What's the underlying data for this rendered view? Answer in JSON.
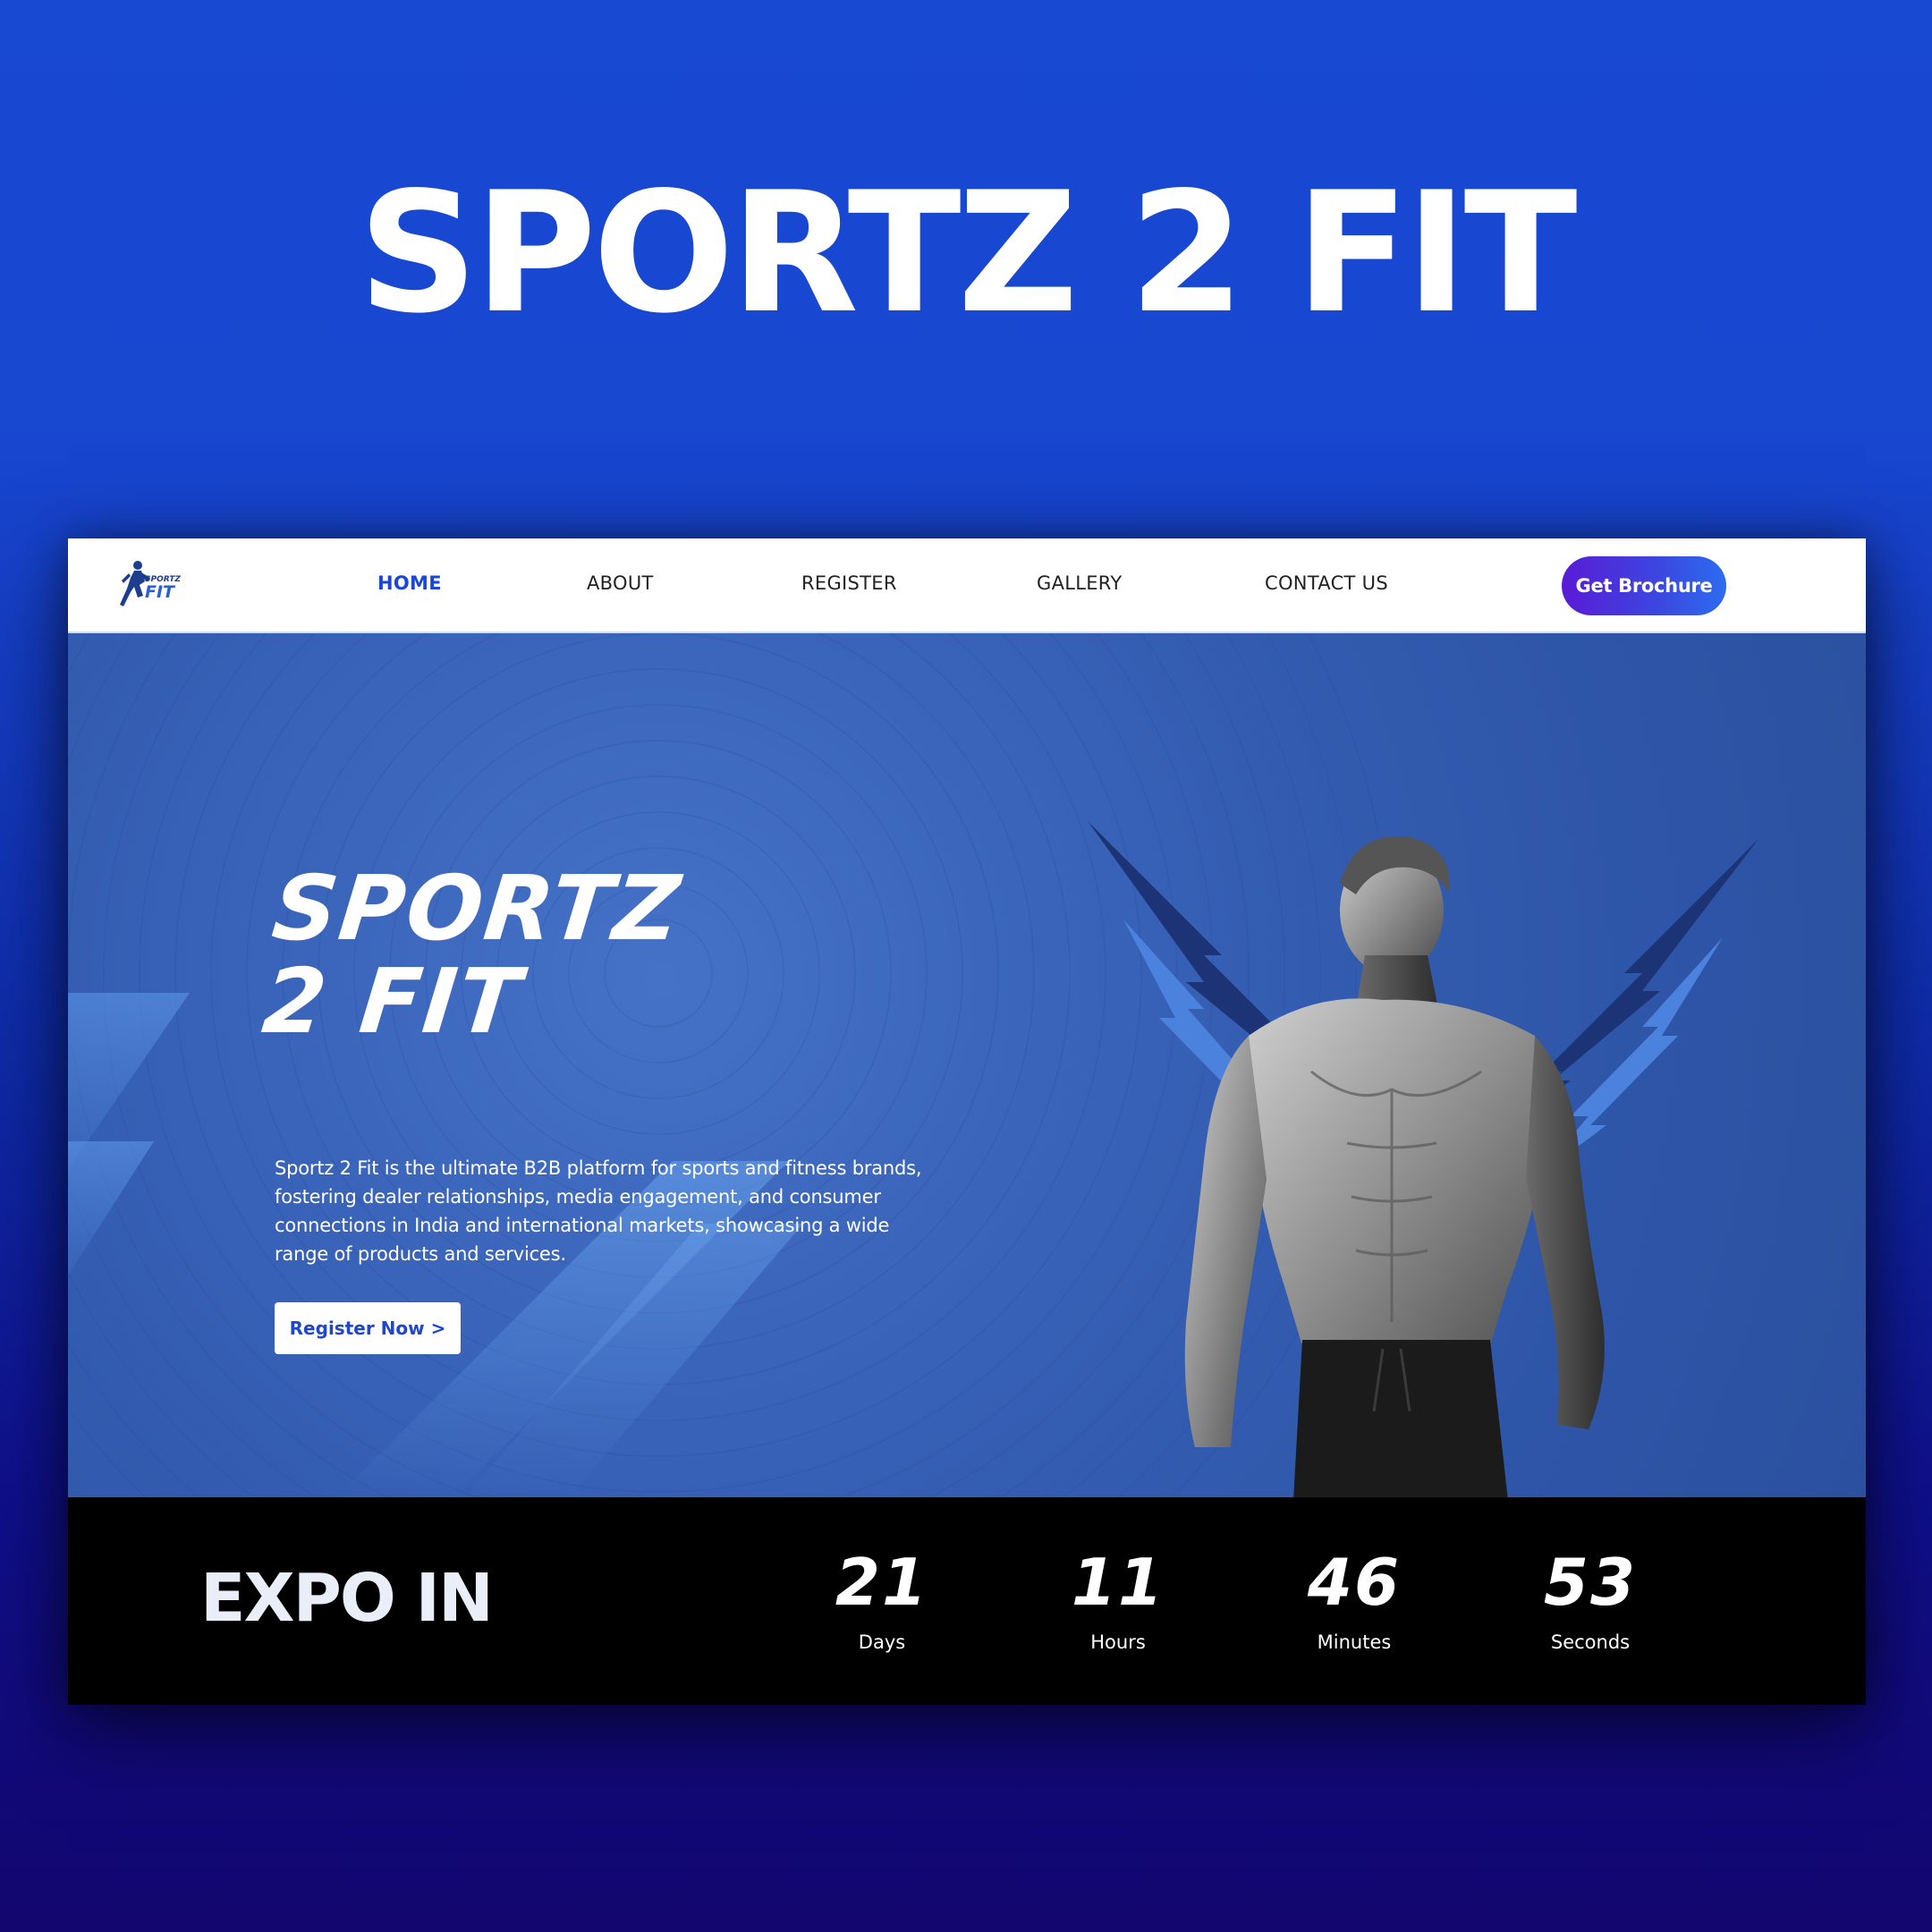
{
  "poster": {
    "title": "SPORTZ 2 FIT"
  },
  "navbar": {
    "logo_text_top": "SPORTZ",
    "logo_text_bottom": "FIT",
    "items": [
      {
        "label": "HOME",
        "active": true
      },
      {
        "label": "ABOUT",
        "active": false
      },
      {
        "label": "REGISTER",
        "active": false
      },
      {
        "label": "GALLERY",
        "active": false
      },
      {
        "label": "CONTACT US",
        "active": false
      }
    ],
    "cta_label": "Get Brochure"
  },
  "hero": {
    "title_line1": "SPORTZ",
    "title_line2": "2 FIT",
    "description": "Sportz 2 Fit is the ultimate B2B platform for sports and fitness brands, fostering dealer relationships, media engagement, and consumer connections in India and international markets, showcasing a wide range of products and services.",
    "register_label": "Register Now >"
  },
  "countdown": {
    "label": "EXPO IN",
    "units": [
      {
        "value": "21",
        "label": "Days"
      },
      {
        "value": "11",
        "label": "Hours"
      },
      {
        "value": "46",
        "label": "Minutes"
      },
      {
        "value": "53",
        "label": "Seconds"
      }
    ]
  },
  "colors": {
    "brand_blue": "#1a47d6",
    "cta_gradient_start": "#5a1bd6",
    "cta_gradient_end": "#2c6cf0",
    "hero_blue": "#3b66bc",
    "countdown_bg": "#000000"
  },
  "icons": {
    "logo": "running-athlete-logo-icon",
    "athlete_image": "shirtless-athlete-photo",
    "bolts": "lightning-bolt-icon"
  }
}
